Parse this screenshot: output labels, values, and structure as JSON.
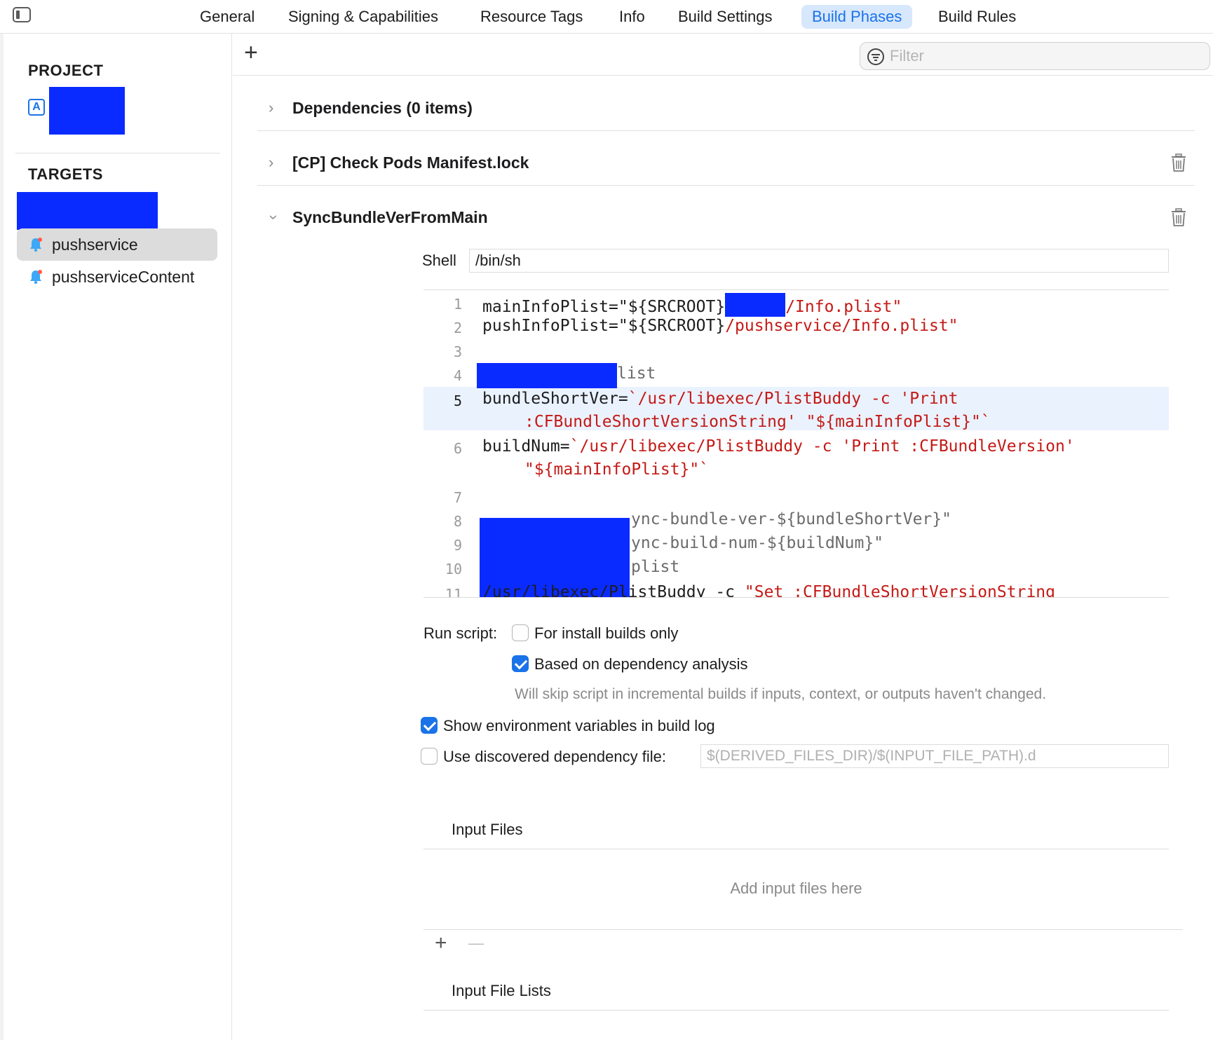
{
  "tabs": [
    {
      "label": "General"
    },
    {
      "label": "Signing & Capabilities"
    },
    {
      "label": "Resource Tags"
    },
    {
      "label": "Info"
    },
    {
      "label": "Build Settings"
    },
    {
      "label": "Build Phases",
      "active": true
    },
    {
      "label": "Build Rules"
    }
  ],
  "sidebar": {
    "project_heading": "PROJECT",
    "targets_heading": "TARGETS",
    "targets": [
      {
        "label": "pushservice",
        "selected": true,
        "icon": "bell-icon"
      },
      {
        "label": "pushserviceContent",
        "selected": false,
        "icon": "bell-icon"
      }
    ]
  },
  "toolbar": {
    "add_symbol": "+",
    "filter_placeholder": "Filter"
  },
  "phases": [
    {
      "title": "Dependencies (0 items)",
      "expanded": false,
      "deletable": false
    },
    {
      "title": "[CP] Check Pods Manifest.lock",
      "expanded": false,
      "deletable": true
    },
    {
      "title": "SyncBundleVerFromMain",
      "expanded": true,
      "deletable": true
    }
  ],
  "script": {
    "shell_label": "Shell",
    "shell_value": "/bin/sh",
    "line_numbers": [
      "1",
      "2",
      "3",
      "4",
      "5",
      "6",
      "7",
      "8",
      "9",
      "10",
      "11"
    ],
    "current_line": "5",
    "code": {
      "l1_a": "mainInfoPlist=\"${SRCROOT}",
      "l1_b": "/Info.plist\"",
      "l2_a": "pushInfoPlist=\"${SRCROOT}",
      "l2_b": "/pushservice/Info.plist\"",
      "l4": "list",
      "l5_a": "bundleShortVer=",
      "l5_b": "`/usr/libexec/PlistBuddy -c 'Print",
      "l5_c": ":CFBundleShortVersionString' \"${mainInfoPlist}\"`",
      "l6_a": "buildNum=",
      "l6_b": "`/usr/libexec/PlistBuddy -c 'Print :CFBundleVersion'",
      "l6_c": "\"${mainInfoPlist}\"`",
      "l8": "ync-bundle-ver-${bundleShortVer}\"",
      "l9": "ync-build-num-${buildNum}\"",
      "l10": "plist",
      "l11_a": "/usr/libexec/PlistBuddy -c ",
      "l11_b": "\"Set :CFBundleShortVersionString"
    }
  },
  "options": {
    "run_script_label": "Run script:",
    "install_builds_label": "For install builds only",
    "install_builds_checked": false,
    "dependency_analysis_label": "Based on dependency analysis",
    "dependency_analysis_checked": true,
    "dependency_note": "Will skip script in incremental builds if inputs, context, or outputs haven't changed.",
    "show_env_label": "Show environment variables in build log",
    "show_env_checked": true,
    "discovered_dep_label": "Use discovered dependency file:",
    "discovered_dep_checked": false,
    "discovered_dep_placeholder": "$(DERIVED_FILES_DIR)/$(INPUT_FILE_PATH).d"
  },
  "input_files": {
    "heading": "Input Files",
    "empty_text": "Add input files here",
    "add_symbol": "+",
    "remove_symbol": "—"
  },
  "input_file_lists": {
    "heading": "Input File Lists"
  },
  "colors": {
    "accent": "#1a73e8",
    "redaction": "#0a2bff",
    "string": "#c41a16",
    "current_line_bg": "#eaf2fe"
  }
}
